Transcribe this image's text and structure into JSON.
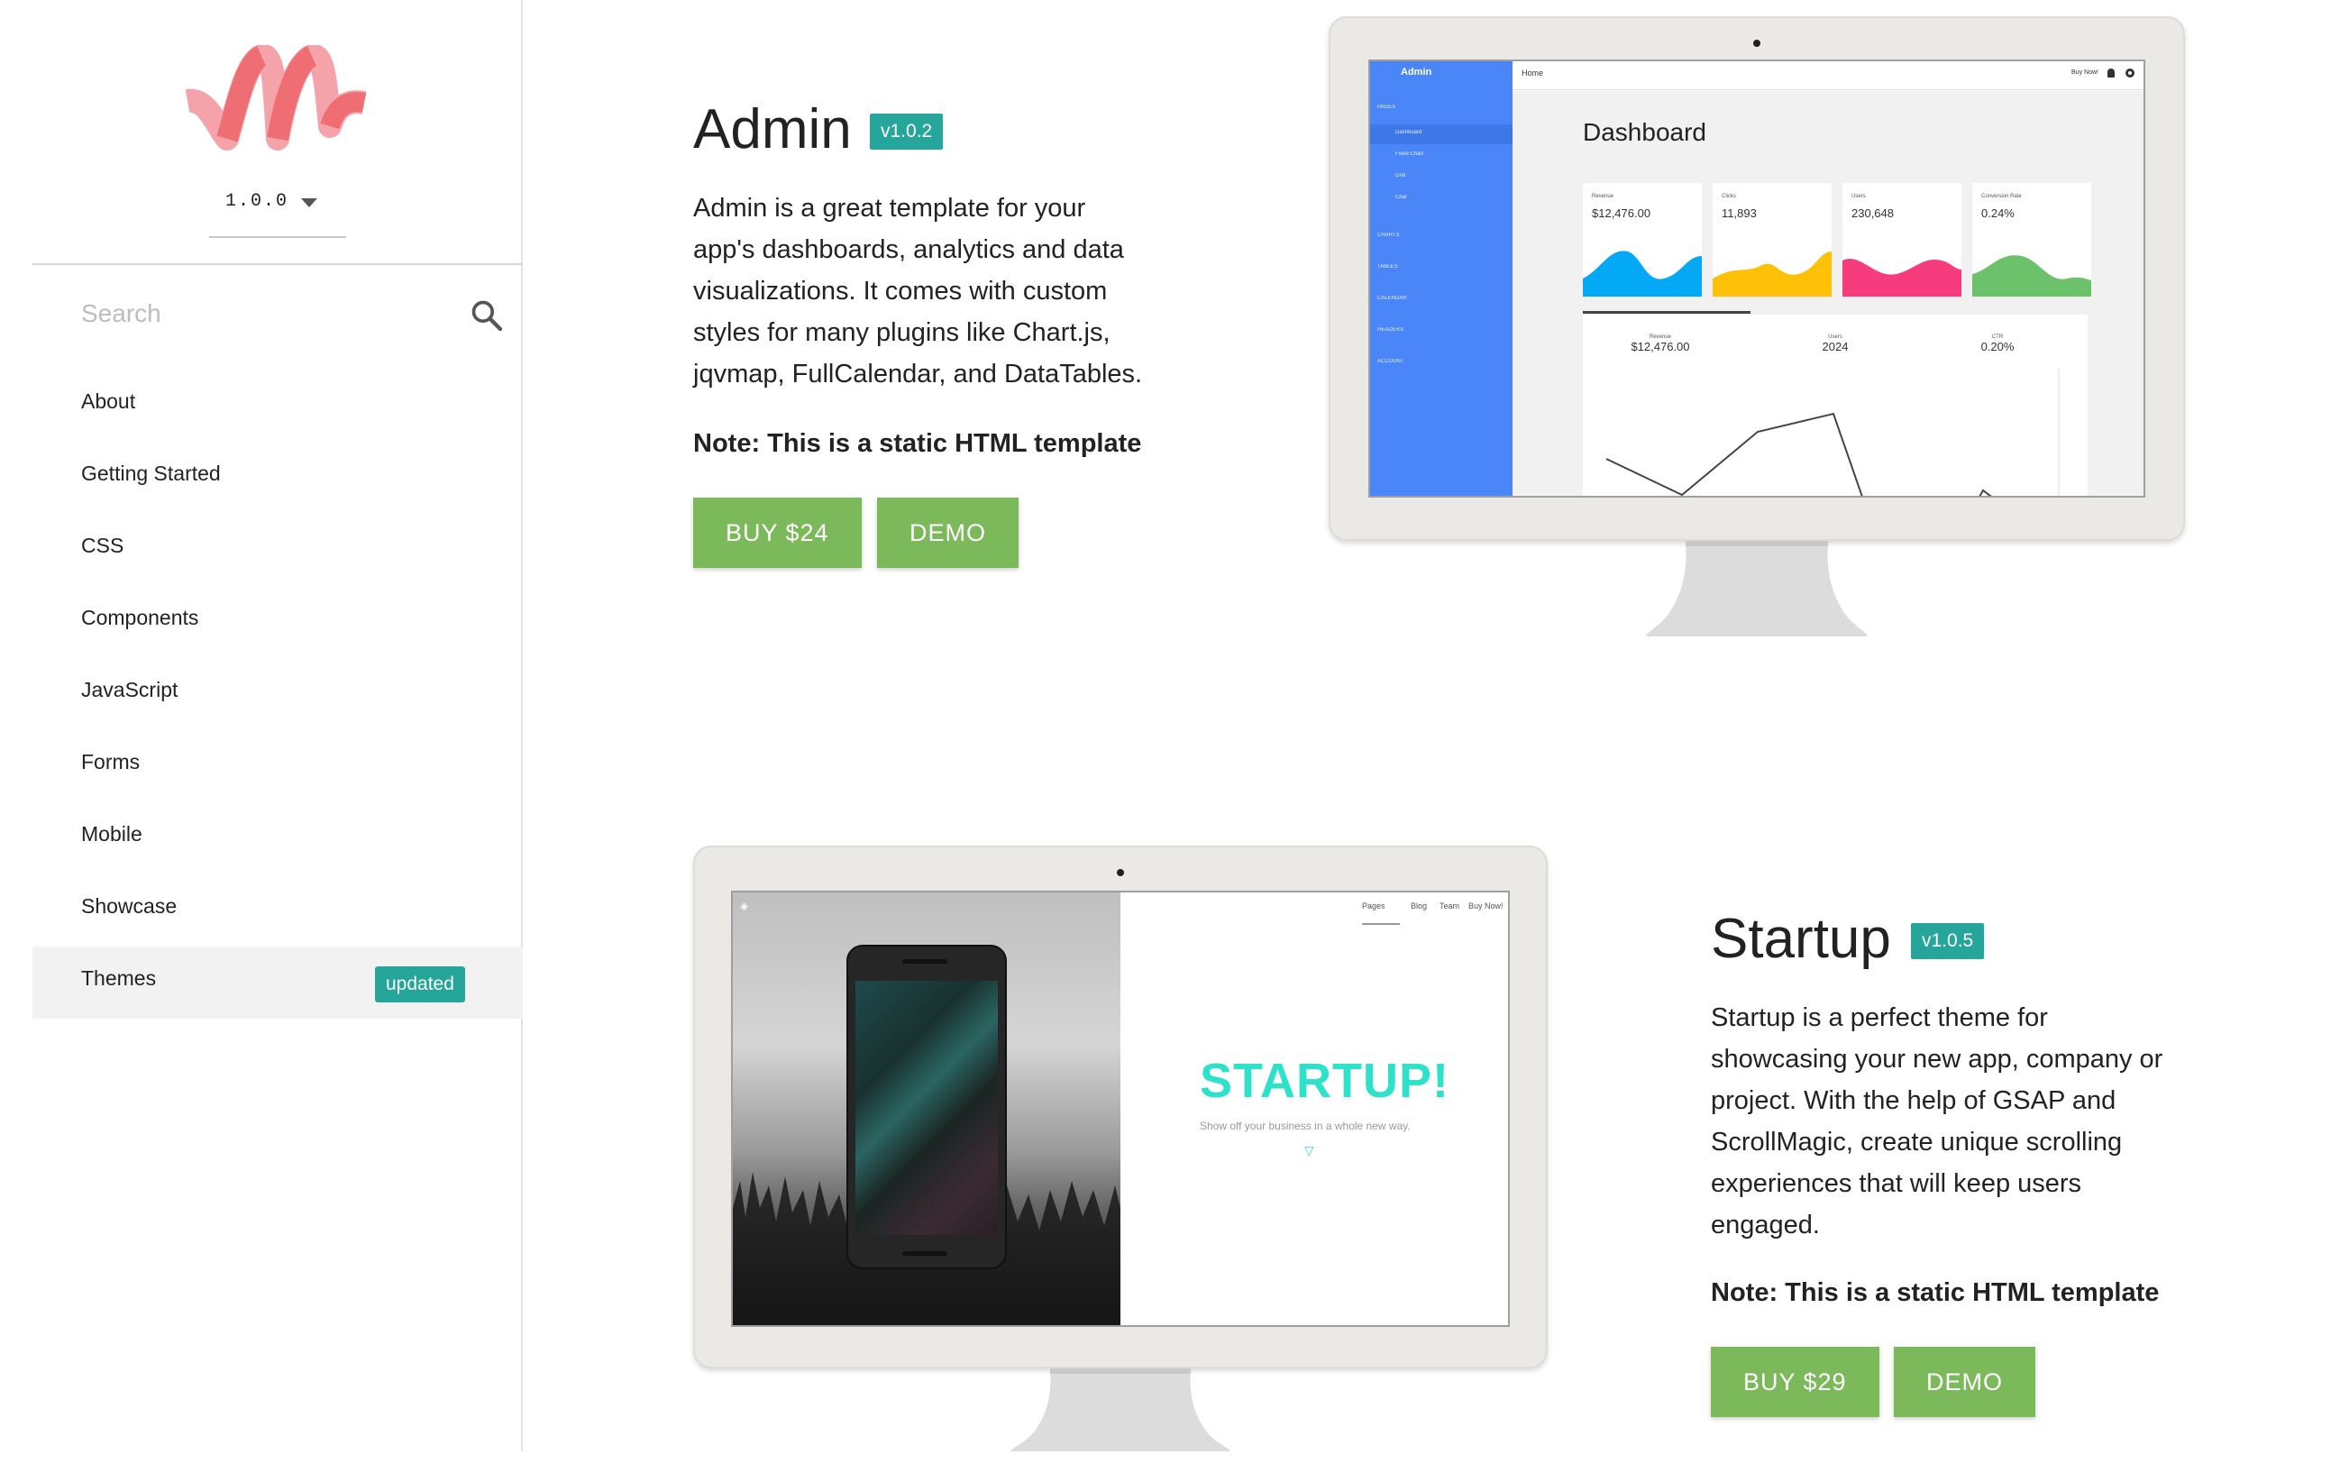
{
  "brand": {
    "logo": "materialize-m-logo",
    "accent": "#ee6e73"
  },
  "version_select": {
    "value": "1.0.0"
  },
  "search": {
    "placeholder": "Search"
  },
  "nav": {
    "items": [
      {
        "label": "About"
      },
      {
        "label": "Getting Started"
      },
      {
        "label": "CSS"
      },
      {
        "label": "Components"
      },
      {
        "label": "JavaScript"
      },
      {
        "label": "Forms"
      },
      {
        "label": "Mobile"
      },
      {
        "label": "Showcase"
      },
      {
        "label": "Themes",
        "badge": "updated",
        "active": true
      }
    ]
  },
  "colors": {
    "badge": "#26a69a",
    "button": "#7cb95a",
    "admin_sidebar": "#4a86f7",
    "startup_accent": "#2de2c8"
  },
  "themes": [
    {
      "name": "Admin",
      "version": "v1.0.2",
      "description": "Admin is a great template for your app's dashboards, analytics and data visualizations. It comes with custom styles for many plugins like Chart.js, jqvmap, FullCalendar, and DataTables.",
      "description_lines": [
        "Admin is a great template for your",
        "app's dashboards, analytics and data",
        "visualizations. It comes with custom",
        "styles for many plugins like Chart.js,",
        "jqvmap, FullCalendar, and DataTables."
      ],
      "note": "Note: This is a static HTML template",
      "buy_label": "BUY $24",
      "demo_label": "DEMO",
      "preview": {
        "brand": "Admin",
        "topbar_home": "Home",
        "topbar_buy": "Buy Now!",
        "heading": "Dashboard",
        "sidebar_links": [
          "PAGES",
          "Dashboard",
          "Fixed Chart",
          "Grid",
          "Chat",
          "CHARTS",
          "TABLES",
          "CALENDAR",
          "HEADERS",
          "ACCOUNT"
        ],
        "cards": [
          {
            "title": "Revenue",
            "value": "$12,476.00",
            "color": "#03a9f4"
          },
          {
            "title": "Clicks",
            "value": "11,893",
            "color": "#ffc107"
          },
          {
            "title": "Users",
            "value": "230,648",
            "color": "#f73c7e"
          },
          {
            "title": "Conversion Rate",
            "value": "0.24%",
            "color": "#6bc26b"
          }
        ],
        "stats": [
          {
            "title": "Revenue",
            "value": "$12,476.00"
          },
          {
            "title": "Users",
            "value": "2024"
          },
          {
            "title": "CTR",
            "value": "0.20%"
          }
        ]
      }
    },
    {
      "name": "Startup",
      "version": "v1.0.5",
      "description": "Startup is a perfect theme for showcasing your new app, company or project. With the help of GSAP and ScrollMagic, create unique scrolling experiences that will keep users engaged.",
      "description_lines": [
        "Startup is a perfect theme for",
        "showcasing your new app, company or",
        "project. With the help of GSAP and",
        "ScrollMagic, create unique scrolling",
        "experiences that will keep users",
        "engaged."
      ],
      "note": "Note: This is a static HTML template",
      "buy_label": "BUY $29",
      "demo_label": "DEMO",
      "preview": {
        "nav": [
          "Pages",
          "Blog",
          "Team",
          "Buy Now!"
        ],
        "headline": "STARTUP!",
        "subline": "Show off your business in a whole new way."
      }
    }
  ]
}
